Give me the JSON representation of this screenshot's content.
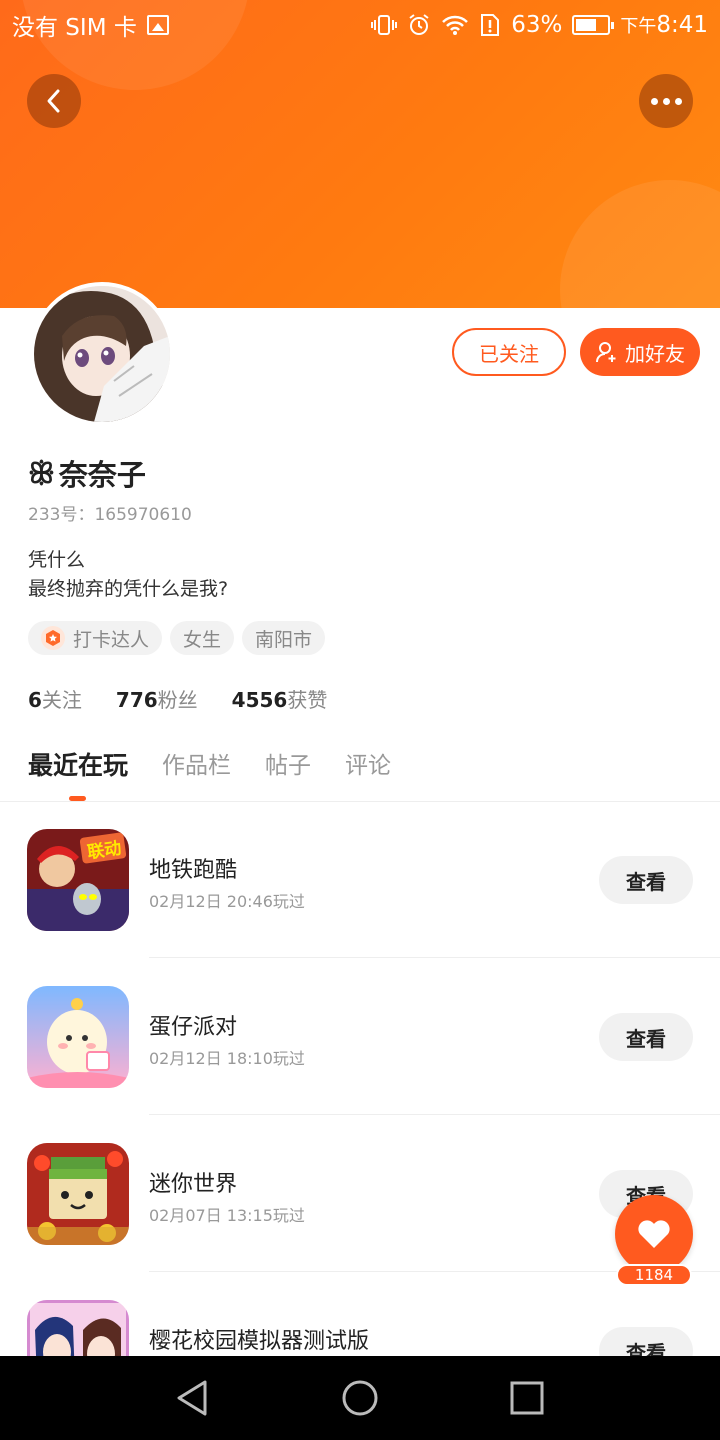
{
  "status_bar": {
    "carrier": "没有 SIM 卡",
    "battery": "63%",
    "ampm": "下午",
    "time": "8:41"
  },
  "header": {
    "back_icon": "chevron-left-icon",
    "more_icon": "more-dots-icon",
    "banner_color": "#ff7510"
  },
  "profile": {
    "name_prefix": "ꕥ",
    "name": "奈奈子",
    "id_text": "233号：165970610",
    "bio_line1": "凭什么",
    "bio_line2": "最终抛弃的凭什么是我?",
    "tags": [
      "打卡达人",
      "女生",
      "南阳市"
    ],
    "followed_label": "已关注",
    "add_friend_label": "加好友",
    "stats": {
      "following_count": "6",
      "following_label": "关注",
      "fans_count": "776",
      "fans_label": "粉丝",
      "likes_count": "4556",
      "likes_label": "获赞"
    }
  },
  "tabs": [
    "最近在玩",
    "作品栏",
    "帖子",
    "评论"
  ],
  "games": [
    {
      "name": "地铁跑酷",
      "time": "02月12日 20:46玩过",
      "action": "查看",
      "icon_badge": "联动"
    },
    {
      "name": "蛋仔派对",
      "time": "02月12日 18:10玩过",
      "action": "查看"
    },
    {
      "name": "迷你世界",
      "time": "02月07日 13:15玩过",
      "action": "查看"
    },
    {
      "name": "樱花校园模拟器测试版",
      "time": "",
      "action": "查看"
    }
  ],
  "fab": {
    "count": "1184",
    "icon": "heart-icon"
  },
  "accent": "#ff5a1f"
}
